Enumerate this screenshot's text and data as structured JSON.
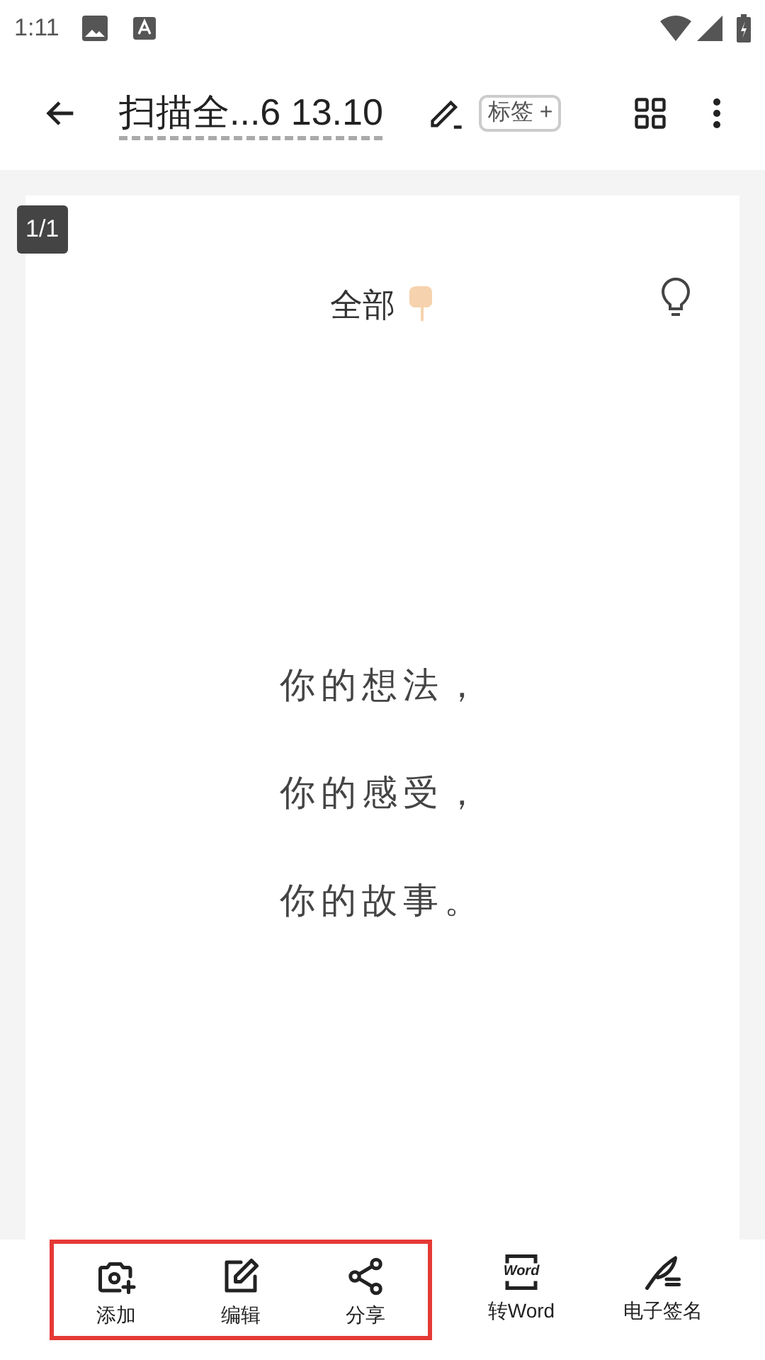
{
  "status_bar": {
    "time": "1:11"
  },
  "toolbar": {
    "title": "扫描全...6 13.10",
    "tag_button": "标签 +"
  },
  "page": {
    "counter": "1/1",
    "heading": "全部",
    "lines": [
      "你的想法，",
      "你的感受，",
      "你的故事。"
    ]
  },
  "bottom_bar": [
    {
      "kind": "camera-plus",
      "label": "添加",
      "highlighted": true
    },
    {
      "kind": "edit",
      "label": "编辑",
      "highlighted": true
    },
    {
      "kind": "share",
      "label": "分享",
      "highlighted": true
    },
    {
      "kind": "word",
      "icon_text": "Word",
      "label": "转Word",
      "highlighted": false
    },
    {
      "kind": "signature",
      "label": "电子签名",
      "highlighted": false
    }
  ]
}
